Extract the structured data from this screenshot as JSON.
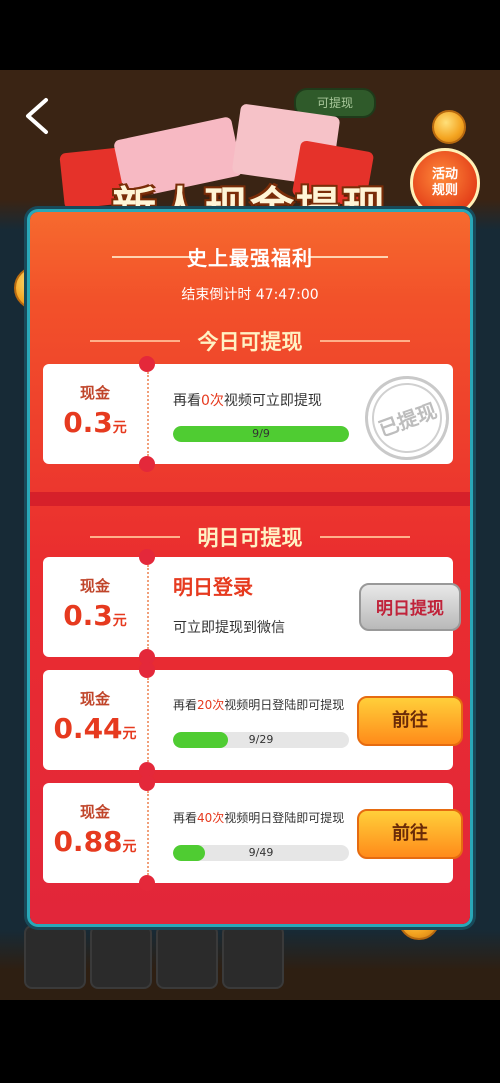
{
  "header": {
    "title": "新人现金提现",
    "rules_label": "活动\n规则",
    "game_pill": "可提现"
  },
  "panel": {
    "subtitle": "史上最强福利",
    "countdown_label": "结束倒计时 47:47:00"
  },
  "today": {
    "section_title": "今日可提现",
    "card": {
      "cash_label": "现金",
      "amount": "0.3",
      "unit": "元",
      "task_prefix": "再看",
      "task_count": "0次",
      "task_suffix": "视频可立即提现",
      "progress_text": "9/9",
      "progress": 1.0,
      "stamp": "已提现"
    }
  },
  "tomorrow": {
    "section_title": "明日可提现",
    "cards": [
      {
        "cash_label": "现金",
        "amount": "0.3",
        "unit": "元",
        "title": "明日登录",
        "subtitle": "可立即提现到微信",
        "button": "明日提现"
      },
      {
        "cash_label": "现金",
        "amount": "0.44",
        "unit": "元",
        "task_prefix": "再看",
        "task_count": "20次",
        "task_suffix": "视频明日登陆即可提现",
        "progress_text": "9/29",
        "progress": 0.31,
        "button": "前往"
      },
      {
        "cash_label": "现金",
        "amount": "0.88",
        "unit": "元",
        "task_prefix": "再看",
        "task_count": "40次",
        "task_suffix": "视频明日登陆即可提现",
        "progress_text": "9/49",
        "progress": 0.18,
        "button": "前往"
      }
    ]
  },
  "colors": {
    "panel": "#f2512a",
    "accent": "#e63a1f",
    "progress": "#4fcc32",
    "button_orange": "#ff8b1a"
  }
}
